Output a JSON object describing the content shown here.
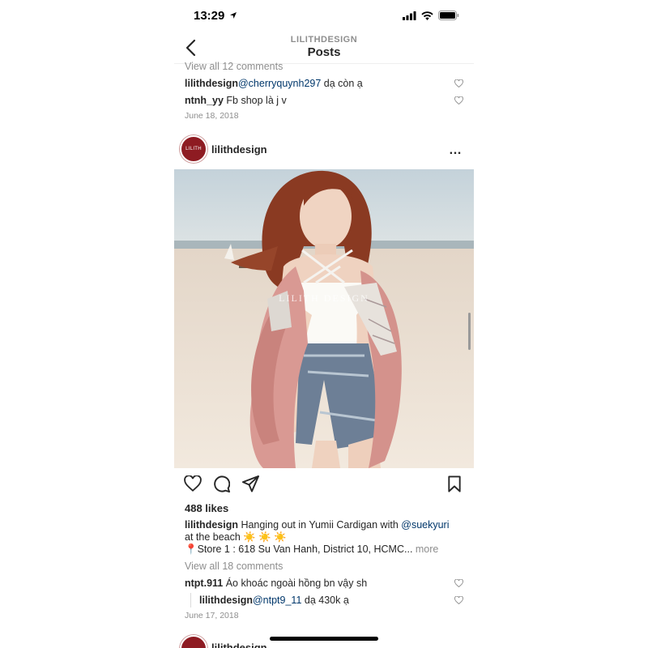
{
  "status_bar": {
    "time": "13:29"
  },
  "header": {
    "account": "LILITHDESIGN",
    "title": "Posts"
  },
  "prev_post": {
    "view_all_comments": "View all 12 comments",
    "comments": [
      {
        "user": "lilithdesign",
        "mention": "@cherryquynh297",
        "text": " dạ còn ạ"
      },
      {
        "user": "ntnh_yy",
        "mention": "",
        "text": " Fb shop là j v"
      }
    ],
    "date": "June 18, 2018"
  },
  "post": {
    "avatar_text": "LILITH",
    "username": "lilithdesign",
    "more_icon": "…",
    "watermark": "LILITH DESIGN",
    "likes": "488 likes",
    "caption": {
      "user": "lilithdesign",
      "text": " Hanging out in Yumii Cardigan with ",
      "mention": "@suekyuri",
      "line2": "at the beach ☀️ ☀️ ☀️",
      "line3": "📍Store 1 : 618 Su Van Hanh, District 10, HCMC...",
      "more": " more"
    },
    "view_all_comments": "View all 18 comments",
    "comments": [
      {
        "user": "ntpt.911",
        "mention": "",
        "text": " Áo khoác ngoài hồng bn vậy sh"
      },
      {
        "user": "lilithdesign",
        "mention": "@ntpt9_11",
        "text": " dạ 430k ạ"
      }
    ],
    "date": "June 17, 2018"
  },
  "next_post": {
    "username": "lilithdesign"
  },
  "icons": {
    "status": [
      "location-arrow-icon",
      "signal-icon",
      "wifi-icon",
      "battery-icon"
    ],
    "actions": [
      "heart-icon",
      "comment-icon",
      "share-icon",
      "bookmark-icon"
    ]
  },
  "colors": {
    "mention": "#00376b",
    "muted": "#8e8e8e",
    "avatar": "#8e1b22"
  }
}
